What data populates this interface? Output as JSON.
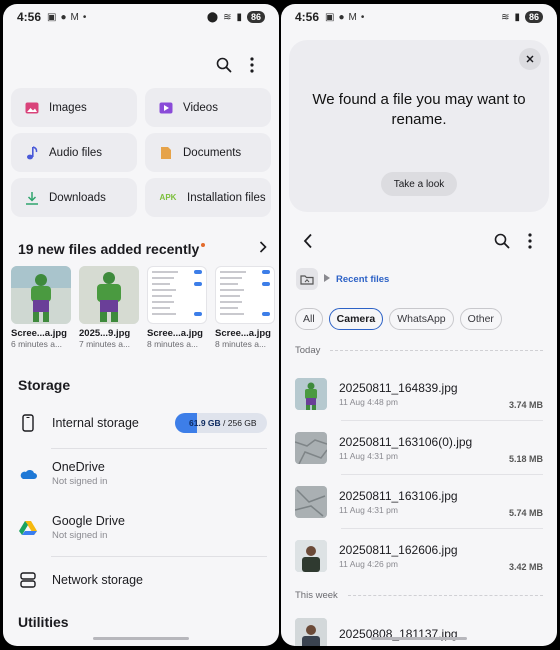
{
  "status_left": {
    "time": "4:56",
    "battery": "86"
  },
  "status_right": {
    "time": "4:56",
    "battery": "86"
  },
  "categories": [
    {
      "label": "Images",
      "icon": "image-icon",
      "color": "#d9437a"
    },
    {
      "label": "Videos",
      "icon": "video-icon",
      "color": "#8a4bd8"
    },
    {
      "label": "Audio files",
      "icon": "music-note-icon",
      "color": "#4a5ad8"
    },
    {
      "label": "Documents",
      "icon": "document-icon",
      "color": "#e6a34a"
    },
    {
      "label": "Downloads",
      "icon": "download-icon",
      "color": "#2fa56d"
    },
    {
      "label": "Installation files",
      "icon": "apk-icon",
      "color": "#7cbf3b"
    }
  ],
  "recent": {
    "title": "19 new files added recently",
    "items": [
      {
        "name": "Scree...a.jpg",
        "time": "6 minutes a..."
      },
      {
        "name": "2025...9.jpg",
        "time": "7 minutes a..."
      },
      {
        "name": "Scree...a.jpg",
        "time": "8 minutes a..."
      },
      {
        "name": "Scree...a.jpg",
        "time": "8 minutes a..."
      }
    ]
  },
  "storage": {
    "title": "Storage",
    "internal": {
      "label": "Internal storage",
      "used": "61.9 GB",
      "total": " / 256 GB",
      "fraction": 0.242
    },
    "onedrive": {
      "label": "OneDrive",
      "sub": "Not signed in"
    },
    "gdrive": {
      "label": "Google Drive",
      "sub": "Not signed in"
    },
    "network": {
      "label": "Network storage"
    }
  },
  "utilities": {
    "title": "Utilities"
  },
  "banner": {
    "text": "We found a file you may want to rename.",
    "button": "Take a look"
  },
  "path": {
    "label": "Recent files"
  },
  "filters": [
    {
      "label": "All",
      "active": false
    },
    {
      "label": "Camera",
      "active": true
    },
    {
      "label": "WhatsApp",
      "active": false
    },
    {
      "label": "Other",
      "active": false
    }
  ],
  "groups": {
    "today": "Today",
    "this_week": "This week"
  },
  "files": [
    {
      "name": "20250811_164839.jpg",
      "date": "11 Aug 4:48 pm",
      "size": "3.74 MB"
    },
    {
      "name": "20250811_163106(0).jpg",
      "date": "11 Aug 4:31 pm",
      "size": "5.18 MB"
    },
    {
      "name": "20250811_163106.jpg",
      "date": "11 Aug 4:31 pm",
      "size": "5.74 MB"
    },
    {
      "name": "20250811_162606.jpg",
      "date": "11 Aug 4:26 pm",
      "size": "3.42 MB"
    },
    {
      "name": "20250808_181137.jpg"
    }
  ]
}
